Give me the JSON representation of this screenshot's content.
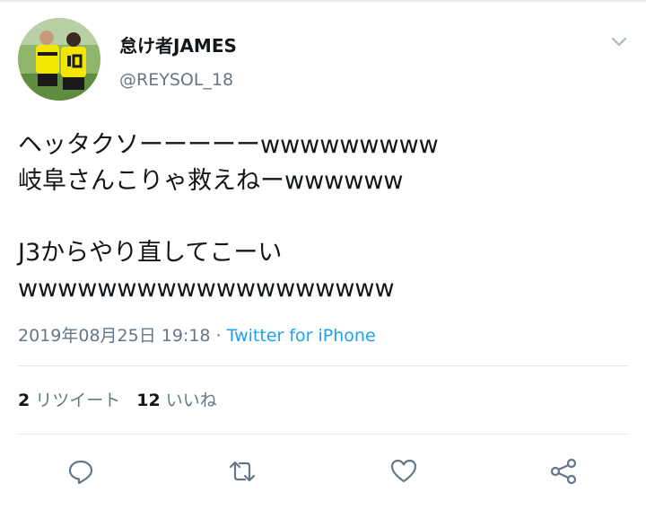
{
  "user": {
    "display_name": "怠け者JAMES",
    "handle": "@REYSOL_18"
  },
  "tweet": {
    "lines": [
      "ヘッタクソーーーーーwwwwwwwww",
      "岐阜さんこりゃ救えねーwwwwww",
      "",
      "J3からやり直してこーい",
      "wwwwwwwwwwwwwwwwwww"
    ]
  },
  "meta": {
    "timestamp": "2019年08月25日 19:18",
    "separator": " · ",
    "source": "Twitter for iPhone"
  },
  "stats": {
    "retweets_count": "2",
    "retweets_label": "リツイート",
    "likes_count": "12",
    "likes_label": "いいね"
  },
  "icons": {
    "caret": "chevron-down-icon",
    "reply": "reply-icon",
    "retweet": "retweet-icon",
    "like": "heart-icon",
    "share": "share-icon"
  },
  "colors": {
    "text": "#14171a",
    "secondary": "#657786",
    "link": "#1da1f2",
    "divider": "#e1e8ed",
    "avatar_jersey": "#f3e600"
  }
}
